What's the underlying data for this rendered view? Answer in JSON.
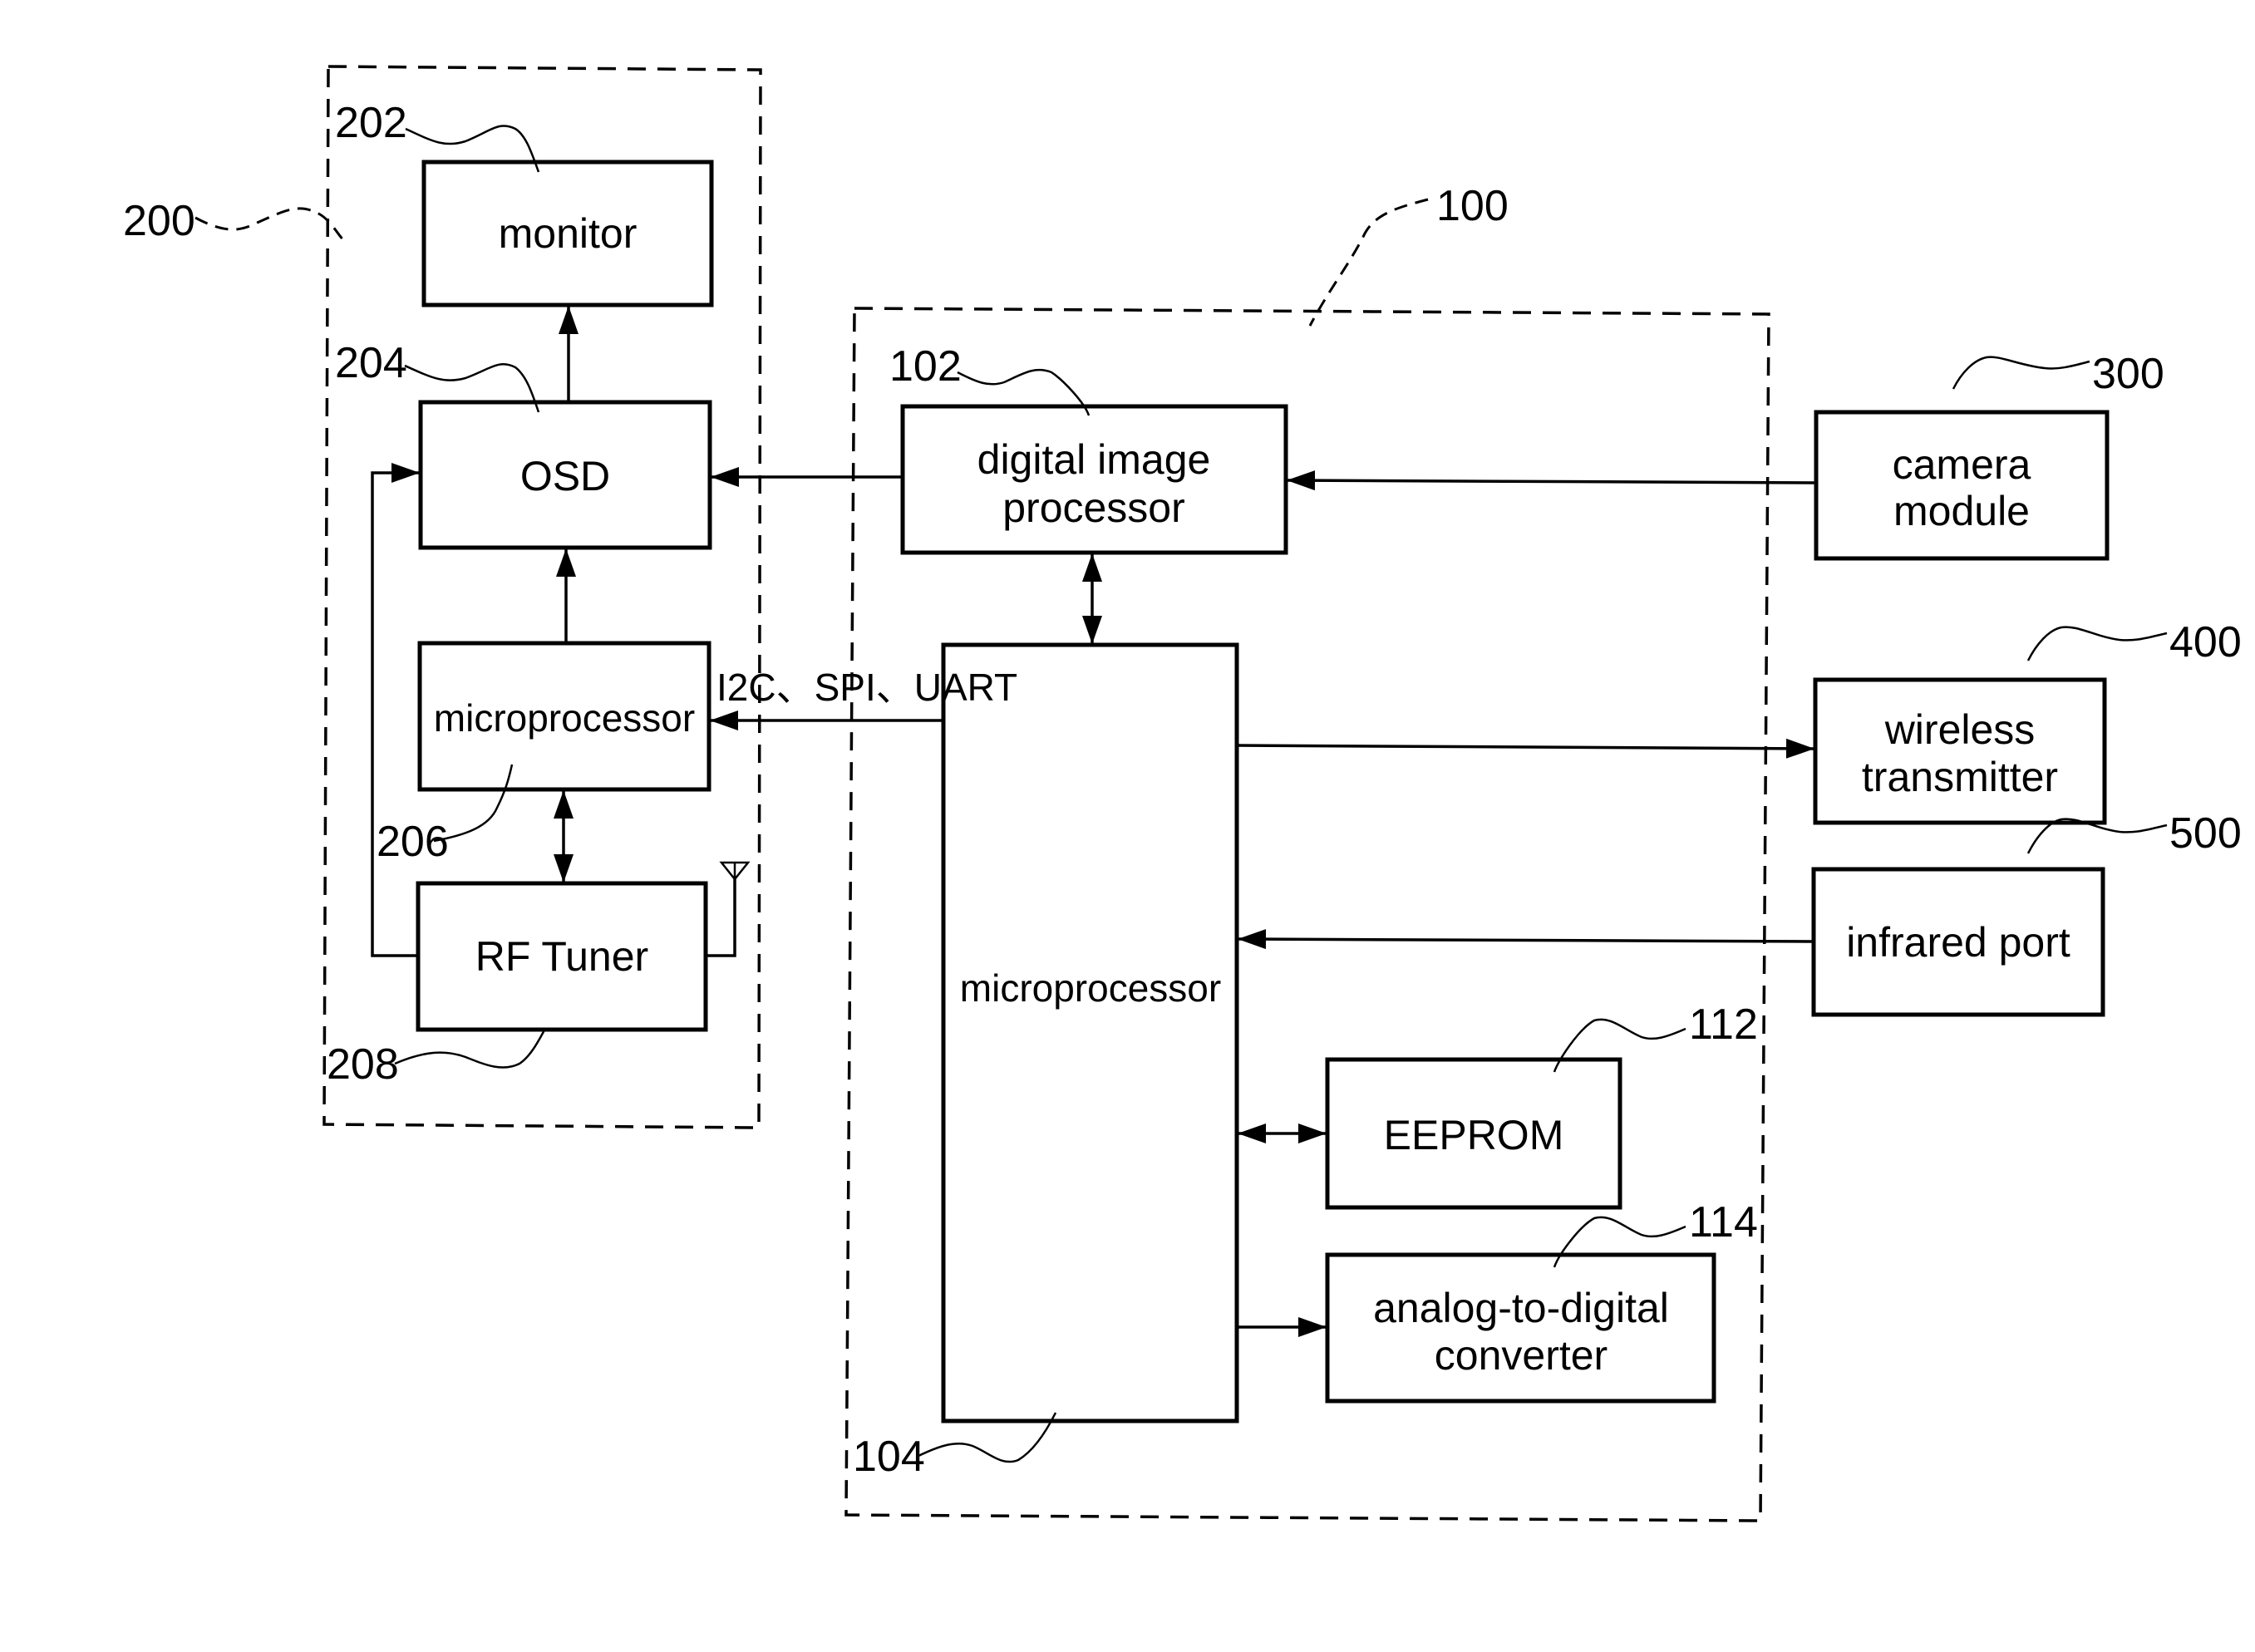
{
  "figure": {
    "groups": {
      "display_unit": {
        "ref": "200"
      },
      "control_unit": {
        "ref": "100"
      }
    },
    "blocks": {
      "monitor": {
        "ref": "202",
        "lines": [
          "monitor"
        ]
      },
      "osd": {
        "ref": "204",
        "lines": [
          "OSD"
        ]
      },
      "display_microprocessor": {
        "ref": "206",
        "lines": [
          "microprocessor"
        ]
      },
      "rf_tuner": {
        "ref": "208",
        "lines": [
          "RF Tuner"
        ]
      },
      "digital_image_processor": {
        "ref": "102",
        "lines": [
          "digital image",
          "processor"
        ]
      },
      "main_microprocessor": {
        "ref": "104",
        "lines": [
          "microprocessor"
        ]
      },
      "eeprom": {
        "ref": "112",
        "lines": [
          "EEPROM"
        ]
      },
      "adc": {
        "ref": "114",
        "lines": [
          "analog-to-digital",
          "converter"
        ]
      },
      "camera_module": {
        "ref": "300",
        "lines": [
          "camera",
          "module"
        ]
      },
      "wireless_transmitter": {
        "ref": "400",
        "lines": [
          "wireless",
          "transmitter"
        ]
      },
      "infrared_port": {
        "ref": "500",
        "lines": [
          "infrared port"
        ]
      }
    },
    "bus_label": "I2C、SPI、UART",
    "connections": [
      {
        "from": "osd",
        "to": "monitor",
        "direction": "one-way"
      },
      {
        "from": "display_microprocessor",
        "to": "osd",
        "direction": "one-way"
      },
      {
        "from": "display_microprocessor",
        "to": "rf_tuner",
        "direction": "two-way"
      },
      {
        "from": "rf_tuner",
        "to": "osd",
        "direction": "one-way"
      },
      {
        "from": "digital_image_processor",
        "to": "osd",
        "direction": "one-way"
      },
      {
        "from": "camera_module",
        "to": "digital_image_processor",
        "direction": "one-way"
      },
      {
        "from": "digital_image_processor",
        "to": "main_microprocessor",
        "direction": "two-way"
      },
      {
        "from": "main_microprocessor",
        "to": "display_microprocessor",
        "direction": "one-way",
        "label": "I2C、SPI、UART"
      },
      {
        "from": "main_microprocessor",
        "to": "wireless_transmitter",
        "direction": "one-way"
      },
      {
        "from": "infrared_port",
        "to": "main_microprocessor",
        "direction": "one-way"
      },
      {
        "from": "main_microprocessor",
        "to": "eeprom",
        "direction": "two-way"
      },
      {
        "from": "main_microprocessor",
        "to": "adc",
        "direction": "one-way"
      }
    ],
    "antenna_icon": "antenna-icon"
  }
}
